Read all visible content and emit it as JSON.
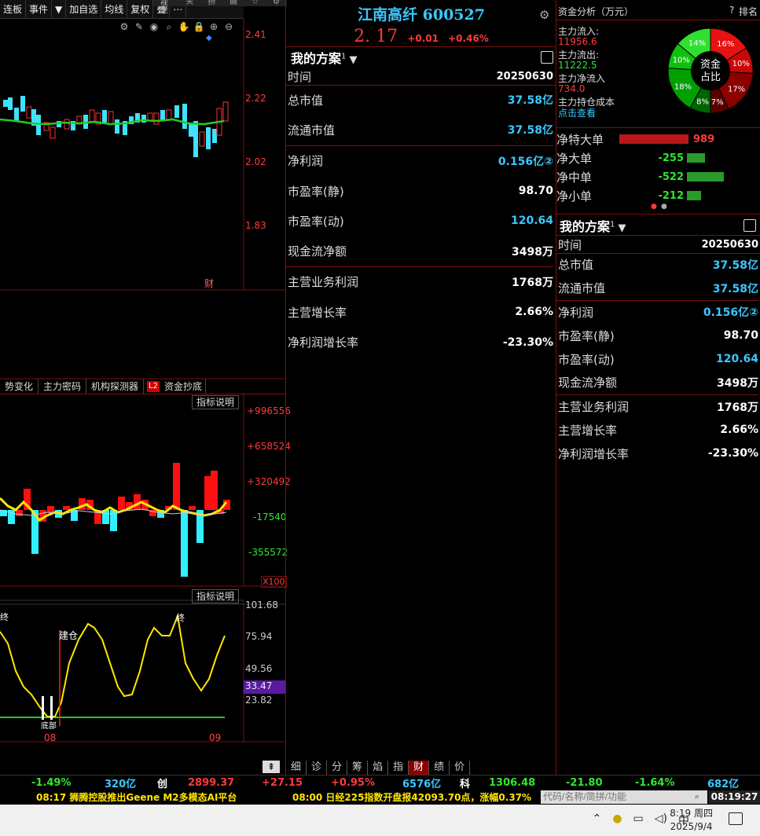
{
  "toolbar": {
    "items": [
      "连板",
      "事件",
      "▼",
      "加自选",
      "均线",
      "复权",
      "叠",
      "⋯"
    ],
    "top_items": [
      "坏竖来",
      "头",
      "扬",
      "画",
      "☆",
      "⚙"
    ]
  },
  "chart": {
    "price_axis": [
      "2.41",
      "2.22",
      "2.02",
      "1.83"
    ],
    "fin_marker": "财",
    "indicator_tabs": [
      "势变化",
      "主力密码",
      "机构探测器",
      "L2",
      "资金抄底"
    ],
    "indicator_btn1": "指标说明",
    "indicator_axis": [
      "+996556",
      "+658524",
      "+320492",
      "-17540",
      "-355572"
    ],
    "x100": "X100",
    "indicator_btn2": "指标说明",
    "osc_axis": [
      "101.68",
      "75.94",
      "49.56",
      "33.47",
      "23.82"
    ],
    "osc_labels": {
      "jiancang": "建仓",
      "zhong1": "终",
      "zhong2": "终",
      "dibu": "底部"
    },
    "date_labels": [
      "08",
      "09"
    ]
  },
  "stock": {
    "title": "江南高纤 600527",
    "price": "2. 17",
    "change": "+0.01",
    "change_pct": "+0.46%"
  },
  "plan_center": {
    "title": "我的方案",
    "superscript": "1",
    "dropdown": "▼",
    "time_label": "时间",
    "time_value": "20250630",
    "rows": [
      {
        "k": "总市值",
        "v": "37.58亿",
        "color": "cyan"
      },
      {
        "k": "流通市值",
        "v": "37.58亿",
        "color": "cyan"
      },
      {
        "k": "净利润",
        "v": "0.156亿②",
        "color": "cyan"
      },
      {
        "k": "市盈率(静)",
        "v": "98.70",
        "color": "white"
      },
      {
        "k": "市盈率(动)",
        "v": "120.64",
        "color": "cyan"
      },
      {
        "k": "现金流净额",
        "v": "3498万",
        "color": "white"
      },
      {
        "k": "主营业务利润",
        "v": "1768万",
        "color": "white"
      },
      {
        "k": "主营增长率",
        "v": "2.66%",
        "color": "white"
      },
      {
        "k": "净利润增长率",
        "v": "-23.30%",
        "color": "white"
      }
    ]
  },
  "bottom_tabs": [
    "细",
    "诊",
    "分",
    "筹",
    "焰",
    "指",
    "财",
    "绩",
    "价"
  ],
  "fund": {
    "title": "资金分析（万元）",
    "help": "?",
    "rank": "排名",
    "inflow_label": "主力流入:",
    "inflow_value": "11956.6",
    "outflow_label": "主力流出:",
    "outflow_value": "11222.5",
    "net_label": "主力净流入",
    "net_value": "734.0",
    "cost_label": "主力持仓成本",
    "cost_link": "点击查看",
    "donut_center": [
      "资金",
      "占比"
    ],
    "donut": [
      {
        "label": "16%",
        "value": 16,
        "color": "#e81010"
      },
      {
        "label": "10%",
        "value": 10,
        "color": "#c80808"
      },
      {
        "label": "17%",
        "value": 17,
        "color": "#8c0000"
      },
      {
        "label": "7%",
        "value": 7,
        "color": "#5a0000"
      },
      {
        "label": "8%",
        "value": 8,
        "color": "#006400"
      },
      {
        "label": "18%",
        "value": 18,
        "color": "#00a000"
      },
      {
        "label": "10%",
        "value": 10,
        "color": "#10c010"
      },
      {
        "label": "14%",
        "value": 14,
        "color": "#30e030"
      }
    ],
    "flows": [
      {
        "label": "净特大单",
        "value": "989",
        "ratio": 1.0,
        "color": "#b81818",
        "vcolor": "red"
      },
      {
        "label": "净大单",
        "value": "-255",
        "ratio": 0.26,
        "color": "#2a9a2a",
        "vcolor": "green"
      },
      {
        "label": "净中单",
        "value": "-522",
        "ratio": 0.53,
        "color": "#2a9a2a",
        "vcolor": "green"
      },
      {
        "label": "净小单",
        "value": "-212",
        "ratio": 0.21,
        "color": "#2a9a2a",
        "vcolor": "green"
      }
    ]
  },
  "plan_right": {
    "title": "我的方案",
    "superscript": "1",
    "dropdown": "▼",
    "time_label": "时间",
    "time_value": "20250630",
    "rows": [
      {
        "k": "总市值",
        "v": "37.58亿",
        "color": "cyan"
      },
      {
        "k": "流通市值",
        "v": "37.58亿",
        "color": "cyan"
      },
      {
        "k": "净利润",
        "v": "0.156亿②",
        "color": "cyan"
      },
      {
        "k": "市盈率(静)",
        "v": "98.70",
        "color": "white"
      },
      {
        "k": "市盈率(动)",
        "v": "120.64",
        "color": "cyan"
      },
      {
        "k": "现金流净额",
        "v": "3498万",
        "color": "white"
      },
      {
        "k": "主营业务利润",
        "v": "1768万",
        "color": "white"
      },
      {
        "k": "主营增长率",
        "v": "2.66%",
        "color": "white"
      },
      {
        "k": "净利润增长率",
        "v": "-23.30%",
        "color": "white"
      }
    ]
  },
  "ticker": [
    {
      "t": "-1.49%",
      "c": "green"
    },
    {
      "t": "320亿",
      "c": "cyan"
    },
    {
      "t": "创",
      "c": "white"
    },
    {
      "t": "2899.37",
      "c": "red"
    },
    {
      "t": "+27.15",
      "c": "red"
    },
    {
      "t": "+0.95%",
      "c": "red"
    },
    {
      "t": "6576亿",
      "c": "cyan"
    },
    {
      "t": "科",
      "c": "white"
    },
    {
      "t": "1306.48",
      "c": "green"
    },
    {
      "t": "-21.80",
      "c": "green"
    },
    {
      "t": "-1.64%",
      "c": "green"
    },
    {
      "t": "682亿",
      "c": "cyan"
    }
  ],
  "news": {
    "item1": "08:17 狮腾控股推出Geene M2多模态AI平台",
    "item2": "08:00 日经225指数开盘报42093.70点，涨幅0.37%",
    "search_placeholder": "代码/名称/简拼/功能",
    "time": "08:19:27"
  },
  "taskbar": {
    "ime": "中",
    "time": "8:19 周四",
    "date": "2025/9/4"
  }
}
